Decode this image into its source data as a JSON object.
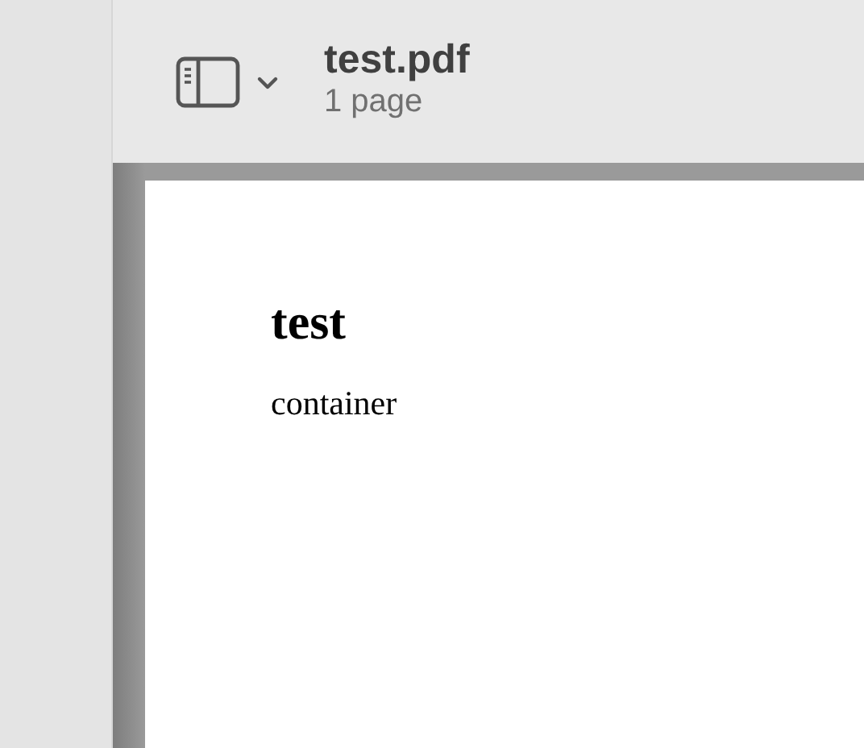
{
  "toolbar": {
    "title": "test.pdf",
    "subtitle": "1 page"
  },
  "document": {
    "heading": "test",
    "body": "container"
  }
}
